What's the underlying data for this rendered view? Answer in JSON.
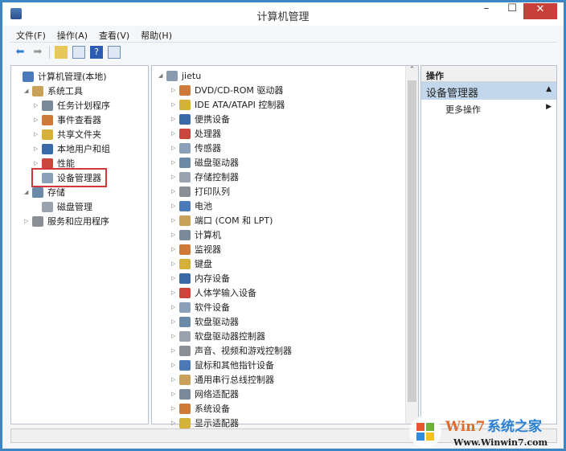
{
  "window": {
    "title": "计算机管理",
    "minimize": "–",
    "maximize": "☐",
    "close": "✕"
  },
  "menu": [
    "文件(F)",
    "操作(A)",
    "查看(V)",
    "帮助(H)"
  ],
  "tree": [
    {
      "label": "计算机管理(本地)",
      "level": 0,
      "exp": ""
    },
    {
      "label": "系统工具",
      "level": 1,
      "exp": "◢"
    },
    {
      "label": "任务计划程序",
      "level": 2,
      "exp": "▷"
    },
    {
      "label": "事件查看器",
      "level": 2,
      "exp": "▷"
    },
    {
      "label": "共享文件夹",
      "level": 2,
      "exp": "▷"
    },
    {
      "label": "本地用户和组",
      "level": 2,
      "exp": "▷"
    },
    {
      "label": "性能",
      "level": 2,
      "exp": "▷"
    },
    {
      "label": "设备管理器",
      "level": 2,
      "exp": "",
      "selected": true
    },
    {
      "label": "存储",
      "level": 1,
      "exp": "◢"
    },
    {
      "label": "磁盘管理",
      "level": 2,
      "exp": ""
    },
    {
      "label": "服务和应用程序",
      "level": 1,
      "exp": "▷"
    }
  ],
  "devices": {
    "root": "jietu",
    "items": [
      "DVD/CD-ROM 驱动器",
      "IDE ATA/ATAPI 控制器",
      "便携设备",
      "处理器",
      "传感器",
      "磁盘驱动器",
      "存储控制器",
      "打印队列",
      "电池",
      "端口 (COM 和 LPT)",
      "计算机",
      "监视器",
      "键盘",
      "内存设备",
      "人体学输入设备",
      "软件设备",
      "软盘驱动器",
      "软盘驱动器控制器",
      "声音、视频和游戏控制器",
      "鼠标和其他指针设备",
      "通用串行总线控制器",
      "网络适配器",
      "系统设备",
      "显示适配器"
    ]
  },
  "actions": {
    "header": "操作",
    "section": "设备管理器",
    "more": "更多操作"
  },
  "watermark": {
    "brand": "Win7系统之家",
    "url": "Www.Winwin7.com"
  },
  "colors": {
    "accent": "#3c86c4",
    "close": "#c7403a",
    "selection": "#d3363b"
  }
}
